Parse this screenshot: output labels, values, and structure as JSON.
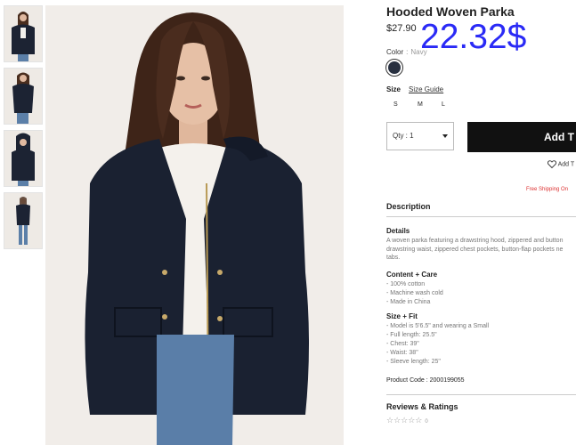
{
  "product": {
    "title": "Hooded Woven Parka",
    "price": "$27.90",
    "converted_price": "22.32$"
  },
  "color": {
    "label": "Color",
    "separator": ":",
    "value": "Navy",
    "swatch_hex": "#283040"
  },
  "size": {
    "label": "Size",
    "guide_label": "Size Guide",
    "options": [
      "S",
      "M",
      "L"
    ]
  },
  "quantity": {
    "label": "Qty : 1"
  },
  "add_to_bag": {
    "label": "Add T"
  },
  "wishlist": {
    "label": "Add T"
  },
  "shipping": {
    "label": "Free Shipping On"
  },
  "description": {
    "heading": "Description",
    "details_heading": "Details",
    "details_lines": [
      "A woven parka featuring a drawstring hood, zippered and button",
      "drawstring waist, zippered chest pockets, button-flap pockets ne",
      "tabs."
    ],
    "content_heading": "Content + Care",
    "content_items": [
      "- 100% cotton",
      "- Machine wash cold",
      "- Made in China"
    ],
    "size_fit_heading": "Size + Fit",
    "size_fit_items": [
      "- Model is 5'6.5\" and wearing a Small",
      "- Full length: 25.5\"",
      "- Chest: 39\"",
      "- Waist: 38\"",
      "- Sleeve length: 25\""
    ],
    "product_code": "Product Code : 2000199055"
  },
  "reviews": {
    "heading": "Reviews & Ratings",
    "stars": "☆☆☆☆☆",
    "count": "0"
  },
  "colors": {
    "accent_price": "#2a2af6",
    "button_bg": "#111111",
    "shipping_text": "#dd3333"
  }
}
